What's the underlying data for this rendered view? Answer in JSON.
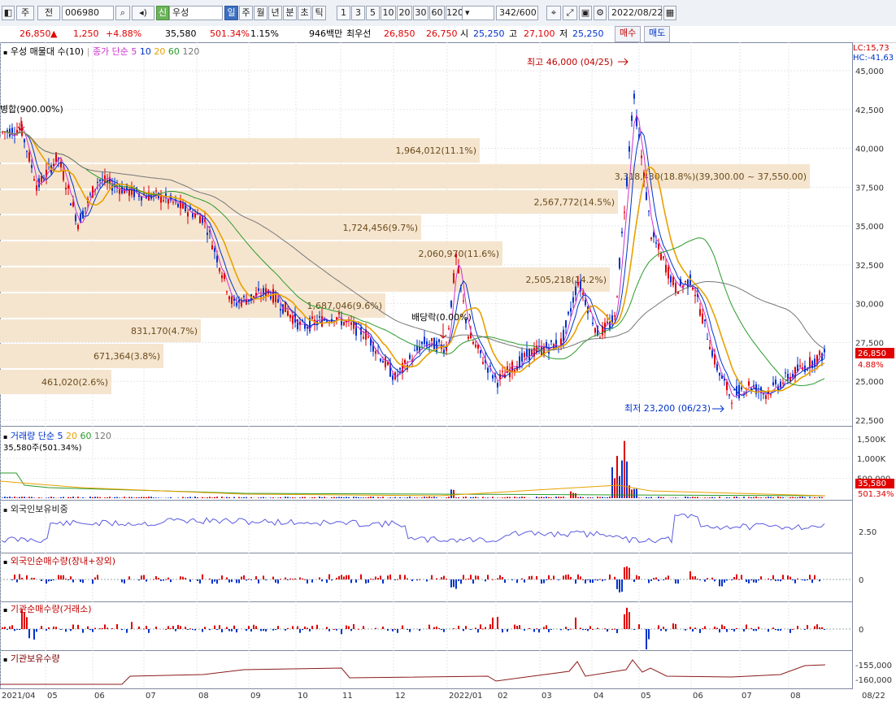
{
  "toolbar": {
    "type_label": "주",
    "prev_label": "전",
    "code": "006980",
    "stock_name": "우성",
    "green_tag": "신",
    "periods": [
      "일",
      "주",
      "월",
      "년",
      "분",
      "초",
      "틱"
    ],
    "active_period": "일",
    "intervals": [
      "1",
      "3",
      "5",
      "10",
      "20",
      "30",
      "60",
      "120"
    ],
    "count": "342/600",
    "date": "2022/08/22"
  },
  "info": {
    "price": "26,850",
    "change_arrow": "▲",
    "change": "1,250",
    "change_pct": "+4.88%",
    "volume": "35,580",
    "volume_ratio": "501.34%",
    "turnover": "1.15%",
    "amount": "946백만",
    "best_ask_label": "최우선",
    "best_ask": "26,850",
    "best_bid": "26,750",
    "open_label": "시",
    "open": "25,250",
    "high_label": "고",
    "high": "27,100",
    "low_label": "저",
    "low": "25,250",
    "buy_label": "매수",
    "sell_label": "매도"
  },
  "price_panel": {
    "legend_main": "우성 매물대 수(10)",
    "legend_ma_label": "종가 단순 5",
    "legend_ma_periods": [
      "10",
      "20",
      "60",
      "120"
    ],
    "lc": "LC:15,73",
    "hc": "HC:-41,63",
    "y_ticks": [
      "45,000",
      "42,500",
      "40,000",
      "37,500",
      "35,000",
      "32,500",
      "30,000",
      "27,500",
      "25,000",
      "22,500"
    ],
    "current_price_tag": "26,850",
    "current_pct_tag": "4.88%",
    "annotation_high": "최고 46,000 (04/25)",
    "annotation_low": "최저 23,200 (06/23)",
    "annotation_merge": "병합(900.00%)",
    "annotation_dividend": "배당락(0.00%)",
    "volume_profile": [
      "1,964,012(11.1%)",
      "3,318,430(18.8%)(39,300.00 ~ 37,550.00)",
      "2,567,772(14.5%)",
      "1,724,456(9.7%)",
      "2,060,970(11.6%)",
      "2,505,218(14.2%)",
      "1,687,046(9.6%)",
      "831,170(4.7%)",
      "671,364(3.8%)",
      "461,020(2.6%)"
    ]
  },
  "volume_panel": {
    "legend_label": "거래량 단순 5",
    "legend_periods": [
      "20",
      "60",
      "120"
    ],
    "value_label": "35,580주(501.34%)",
    "y_ticks": [
      "1,500K",
      "1,000K",
      "500,000"
    ],
    "current_tag": "35,580",
    "current_pct_tag": "501.34%"
  },
  "foreign_ratio_panel": {
    "legend": "외국인보유비중",
    "y_tick": "2.50"
  },
  "foreign_net_panel": {
    "legend": "외국인순매수량(장내+장외)",
    "y_tick": "0"
  },
  "inst_net_panel": {
    "legend": "기관순매수량(거래소)",
    "y_tick": "0"
  },
  "inst_hold_panel": {
    "legend": "기관보유수량",
    "y_ticks": [
      "-155,000",
      "-160,000"
    ]
  },
  "x_axis": [
    "2021/04",
    "05",
    "06",
    "07",
    "08",
    "09",
    "10",
    "11",
    "12",
    "2022/01",
    "02",
    "03",
    "04",
    "05",
    "06",
    "07",
    "08",
    "08/22"
  ],
  "colors": {
    "up": "#e00000",
    "down": "#0033cc",
    "profile": "#f5e5cf",
    "ma5": "#cc33cc",
    "ma20": "#e8a000",
    "ma60": "#2a9a2a",
    "ma120": "#777777"
  }
}
